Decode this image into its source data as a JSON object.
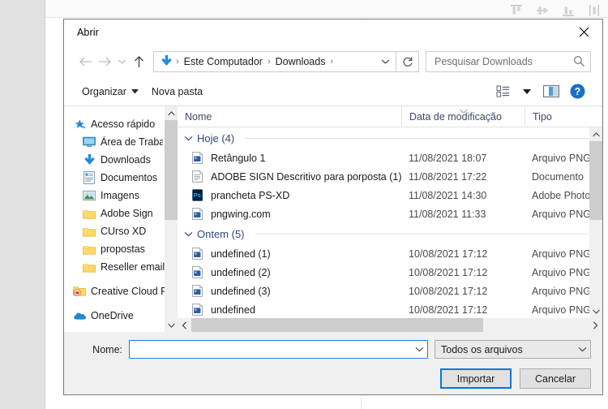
{
  "background": {
    "align_tools": [
      "align-top-icon",
      "align-center-horizontal-icon",
      "align-bottom-icon",
      "distribute-vertical-icon"
    ]
  },
  "dialog": {
    "title": "Abrir",
    "close_icon": "close-icon"
  },
  "nav": {
    "back_icon": "arrow-left-icon",
    "forward_icon": "arrow-right-icon",
    "recent_icon": "chevron-down-icon",
    "up_icon": "arrow-up-icon",
    "breadcrumb": {
      "location_icon": "downloads-arrow-icon",
      "segments": [
        "Este Computador",
        "Downloads"
      ],
      "separator": "›",
      "trailing_separator": "›",
      "dropdown_icon": "chevron-down-icon"
    },
    "refresh_icon": "refresh-icon",
    "search": {
      "placeholder": "Pesquisar Downloads",
      "value": "",
      "icon": "search-icon"
    }
  },
  "commandbar": {
    "organize_label": "Organizar",
    "organize_caret": "caret-down-icon",
    "new_folder_label": "Nova pasta",
    "view_icon": "view-list-icon",
    "view_caret": "caret-down-icon",
    "preview_pane_icon": "preview-pane-icon",
    "help_icon": "help-icon"
  },
  "sidebar": {
    "items": [
      {
        "label": "Acesso rápido",
        "icon": "star-pin-icon",
        "level": 0,
        "pinned": false
      },
      {
        "label": "Área de Traba",
        "icon": "desktop-icon",
        "level": 1,
        "pinned": true
      },
      {
        "label": "Downloads",
        "icon": "downloads-arrow-icon",
        "level": 1,
        "pinned": true
      },
      {
        "label": "Documentos",
        "icon": "documents-icon",
        "level": 1,
        "pinned": true
      },
      {
        "label": "Imagens",
        "icon": "pictures-icon",
        "level": 1,
        "pinned": true
      },
      {
        "label": "Adobe Sign",
        "icon": "folder-icon",
        "level": 1,
        "pinned": false
      },
      {
        "label": "CUrso XD",
        "icon": "folder-icon",
        "level": 1,
        "pinned": false
      },
      {
        "label": "propostas",
        "icon": "folder-icon",
        "level": 1,
        "pinned": false
      },
      {
        "label": "Reseller email te",
        "icon": "folder-icon",
        "level": 1,
        "pinned": false
      },
      {
        "label": "Creative Cloud Fil",
        "icon": "creative-cloud-files-icon",
        "level": 0,
        "pinned": false
      },
      {
        "label": "OneDrive",
        "icon": "onedrive-icon",
        "level": 0,
        "pinned": false
      }
    ],
    "scroll_up_icon": "chevron-up-icon",
    "scroll_down_icon": "chevron-down-icon"
  },
  "filelist": {
    "columns": [
      "Nome",
      "Data de modificação",
      "Tipo"
    ],
    "sort_indicator_icon": "chevron-up-sort-icon",
    "sort_column": "Data de modificação",
    "groups": [
      {
        "label": "Hoje (4)",
        "collapse_icon": "chevron-down-icon",
        "rows": [
          {
            "name": "Retângulo 1",
            "icon": "png-file-icon",
            "date": "11/08/2021 18:07",
            "type": "Arquivo PNG"
          },
          {
            "name": "ADOBE SIGN Descritivo para porposta (1)",
            "icon": "document-file-icon",
            "date": "11/08/2021 17:22",
            "type": "Documento "
          },
          {
            "name": "prancheta PS-XD",
            "icon": "photoshop-file-icon",
            "date": "11/08/2021 14:30",
            "type": "Adobe Photo"
          },
          {
            "name": "pngwing.com",
            "icon": "png-file-icon",
            "date": "11/08/2021 11:33",
            "type": "Arquivo PNG"
          }
        ]
      },
      {
        "label": "Ontem (5)",
        "collapse_icon": "chevron-down-icon",
        "rows": [
          {
            "name": "undefined (1)",
            "icon": "png-file-icon",
            "date": "10/08/2021 17:12",
            "type": "Arquivo PNG"
          },
          {
            "name": "undefined (2)",
            "icon": "png-file-icon",
            "date": "10/08/2021 17:12",
            "type": "Arquivo PNG"
          },
          {
            "name": "undefined (3)",
            "icon": "png-file-icon",
            "date": "10/08/2021 17:12",
            "type": "Arquivo PNG"
          },
          {
            "name": "undefined",
            "icon": "png-file-icon",
            "date": "10/08/2021 17:12",
            "type": "Arquivo PNG"
          }
        ]
      }
    ],
    "vscroll_up_icon": "chevron-up-icon",
    "vscroll_down_icon": "chevron-down-icon",
    "hscroll_left_icon": "chevron-left-icon",
    "hscroll_right_icon": "chevron-right-icon"
  },
  "footer": {
    "name_label": "Nome:",
    "name_value": "",
    "name_dropdown_icon": "chevron-down-icon",
    "filter_value": "Todos os arquivos",
    "filter_chevron_icon": "chevron-down-icon",
    "confirm_label": "Importar",
    "cancel_label": "Cancelar"
  },
  "colors": {
    "accent": "#0078d7",
    "folder": "#ffd968",
    "group_text": "#2b4a82"
  }
}
